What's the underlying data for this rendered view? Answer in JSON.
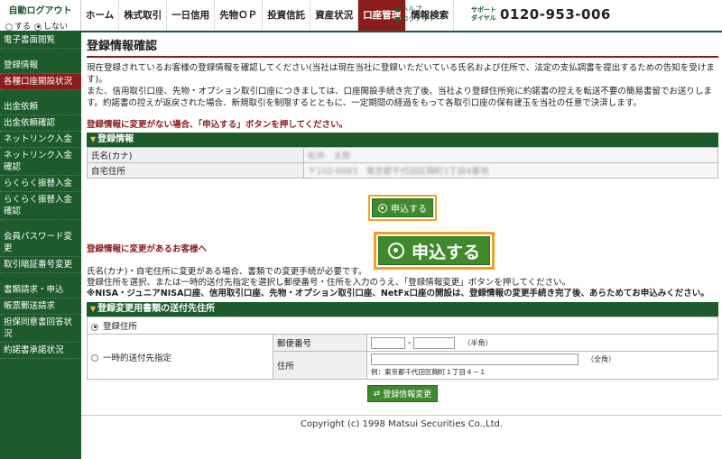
{
  "autologout": {
    "title": "自動ログアウト",
    "opt_on": "する",
    "opt_off": "しない"
  },
  "nav": {
    "tabs": [
      "ホーム",
      "株式取引",
      "一日信用",
      "先物ＯＰ",
      "投資信託",
      "資産状況",
      "口座管理",
      "情報検索"
    ],
    "help": "ヘルプ",
    "logout": "ログアウト",
    "support_label_1": "サポート",
    "support_label_2": "ダイヤル",
    "support_number": "0120-953-006"
  },
  "sidebar": {
    "group1": [
      "電子書面閲覧"
    ],
    "group2": [
      "登録情報",
      "各種口座開設状況"
    ],
    "group3": [
      "出金依頼",
      "出金依頼確認",
      "ネットリンク入金",
      "ネットリンク入金確認",
      "らくらく振替入金",
      "らくらく振替入金確認"
    ],
    "group4": [
      "会員パスワード変更",
      "取引暗証番号変更"
    ],
    "group5": [
      "書類請求・申込",
      "帳票郵送請求",
      "担保同意書回答状況",
      "約諾書承諾状況"
    ]
  },
  "main": {
    "title": "登録情報確認",
    "intro1": "現在登録されているお客様の登録情報を確認してください(当社は現在当社に登録いただいている氏名および住所で、法定の支払調書を提出するための告知を受けます)。",
    "intro2": "また、信用取引口座、先物・オプション取引口座につきましては、口座開設手続き完了後、当社より登録住所宛に約諾書の控えを転送不要の簡易書留でお送りします。約諾書の控えが返戻された場合、新規取引を制限するとともに、一定期間の経過をもって各取引口座の保有建玉を当社の任意で決済します。",
    "nochange_note": "登録情報に変更がない場合、「申込する」ボタンを押してください。",
    "reg_section_title": "登録情報",
    "row_name_label": "氏名(カナ)",
    "row_name_value": "松井　太郎",
    "row_addr_label": "自宅住所",
    "row_addr_value": "〒102-0083　東京都千代田区麹町1丁目4番地",
    "apply_label": "申込する",
    "change_heading": "登録情報に変更があるお客様へ",
    "change_p1": "氏名(カナ)・自宅住所に変更がある場合、書類での変更手続が必要です。",
    "change_p2": "登録住所を選択、または一時的送付先指定を選択し郵便番号・住所を入力のうえ、「登録情報変更」ボタンを押してください。",
    "change_p3": "※NISA・ジュニアNISA口座、信用取引口座、先物・オプション取引口座、NetFx口座の開設は、登録情報の変更手続き完了後、あらためてお申込みください。",
    "dest_section_title": "登録変更用書類の送付先住所",
    "opt_registered": "登録住所",
    "opt_temp": "一時的送付先指定",
    "postal_label": "郵便番号",
    "postal_hint": "（半角）",
    "address_label": "住所",
    "address_hint": "（全角）",
    "address_example": "例：東京都千代田区麹町１丁目４－１",
    "change_button": "登録情報変更"
  },
  "footer": {
    "copyright": "Copyright (c) 1998 Matsui Securities Co.,Ltd."
  },
  "colors": {
    "brand_green": "#1d5a2c",
    "active_red": "#8a1c1c",
    "highlight_orange": "#f3a21f"
  }
}
